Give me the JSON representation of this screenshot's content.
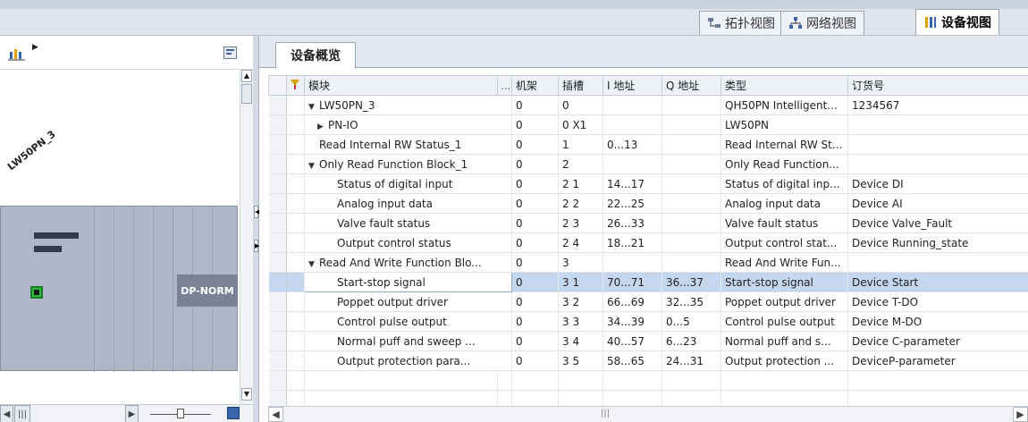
{
  "view_tabs": [
    {
      "label": "拓扑视图",
      "icon": "topology-view-icon"
    },
    {
      "label": "网络视图",
      "icon": "network-view-icon"
    },
    {
      "label": "设备视图",
      "icon": "device-view-icon",
      "active": true
    }
  ],
  "left_panel": {
    "device_name": "LW50PN_3",
    "module_label": "DP-NORM"
  },
  "overview": {
    "tab_label": "设备概览",
    "columns": [
      "模块",
      "...",
      "机架",
      "插槽",
      "I 地址",
      "Q 地址",
      "类型",
      "订货号"
    ],
    "rows": [
      {
        "name": "LW50PN_3",
        "tree": "expanded",
        "indent": 0,
        "rack": "0",
        "slot": "0",
        "i_addr": "",
        "q_addr": "",
        "type": "QH50PN Intelligent...",
        "order": "1234567"
      },
      {
        "name": "PN-IO",
        "tree": "collapsed",
        "indent": 1,
        "rack": "0",
        "slot": "0 X1",
        "i_addr": "",
        "q_addr": "",
        "type": "LW50PN",
        "order": ""
      },
      {
        "name": "Read Internal RW Status_1",
        "tree": "none",
        "indent": 0,
        "rack": "0",
        "slot": "1",
        "i_addr": "0...13",
        "q_addr": "",
        "type": "Read Internal RW St...",
        "order": ""
      },
      {
        "name": "Only Read Function Block_1",
        "tree": "expanded",
        "indent": 0,
        "rack": "0",
        "slot": "2",
        "i_addr": "",
        "q_addr": "",
        "type": "Only Read Function...",
        "order": ""
      },
      {
        "name": "Status of digital input",
        "tree": "none",
        "indent": 2,
        "rack": "0",
        "slot": "2 1",
        "i_addr": "14...17",
        "q_addr": "",
        "type": "Status of digital inp...",
        "order": "Device DI"
      },
      {
        "name": "Analog input data",
        "tree": "none",
        "indent": 2,
        "rack": "0",
        "slot": "2 2",
        "i_addr": "22...25",
        "q_addr": "",
        "type": "Analog input data",
        "order": "Device AI"
      },
      {
        "name": "Valve fault status",
        "tree": "none",
        "indent": 2,
        "rack": "0",
        "slot": "2 3",
        "i_addr": "26...33",
        "q_addr": "",
        "type": "Valve fault status",
        "order": "Device Valve_Fault"
      },
      {
        "name": "Output control status",
        "tree": "none",
        "indent": 2,
        "rack": "0",
        "slot": "2 4",
        "i_addr": "18...21",
        "q_addr": "",
        "type": "Output control stat...",
        "order": "Device Running_state"
      },
      {
        "name": "Read And Write Function Blo...",
        "tree": "expanded",
        "indent": 0,
        "rack": "0",
        "slot": "3",
        "i_addr": "",
        "q_addr": "",
        "type": "Read And Write Fun...",
        "order": ""
      },
      {
        "name": "Start-stop signal",
        "tree": "none",
        "indent": 2,
        "rack": "0",
        "slot": "3 1",
        "i_addr": "70...71",
        "q_addr": "36...37",
        "type": "Start-stop signal",
        "order": "Device Start",
        "selected": true
      },
      {
        "name": "Poppet output driver",
        "tree": "none",
        "indent": 2,
        "rack": "0",
        "slot": "3 2",
        "i_addr": "66...69",
        "q_addr": "32...35",
        "type": "Poppet output driver",
        "order": "Device T-DO"
      },
      {
        "name": "Control pulse output",
        "tree": "none",
        "indent": 2,
        "rack": "0",
        "slot": "3 3",
        "i_addr": "34...39",
        "q_addr": "0...5",
        "type": "Control pulse output",
        "order": "Device M-DO"
      },
      {
        "name": "Normal puff and sweep ...",
        "tree": "none",
        "indent": 2,
        "rack": "0",
        "slot": "3 4",
        "i_addr": "40...57",
        "q_addr": "6...23",
        "type": "Normal puff and s...",
        "order": "Device C-parameter"
      },
      {
        "name": "Output protection para...",
        "tree": "none",
        "indent": 2,
        "rack": "0",
        "slot": "3 5",
        "i_addr": "58...65",
        "q_addr": "24...31",
        "type": "Output protection ...",
        "order": "DeviceP-parameter"
      }
    ]
  }
}
